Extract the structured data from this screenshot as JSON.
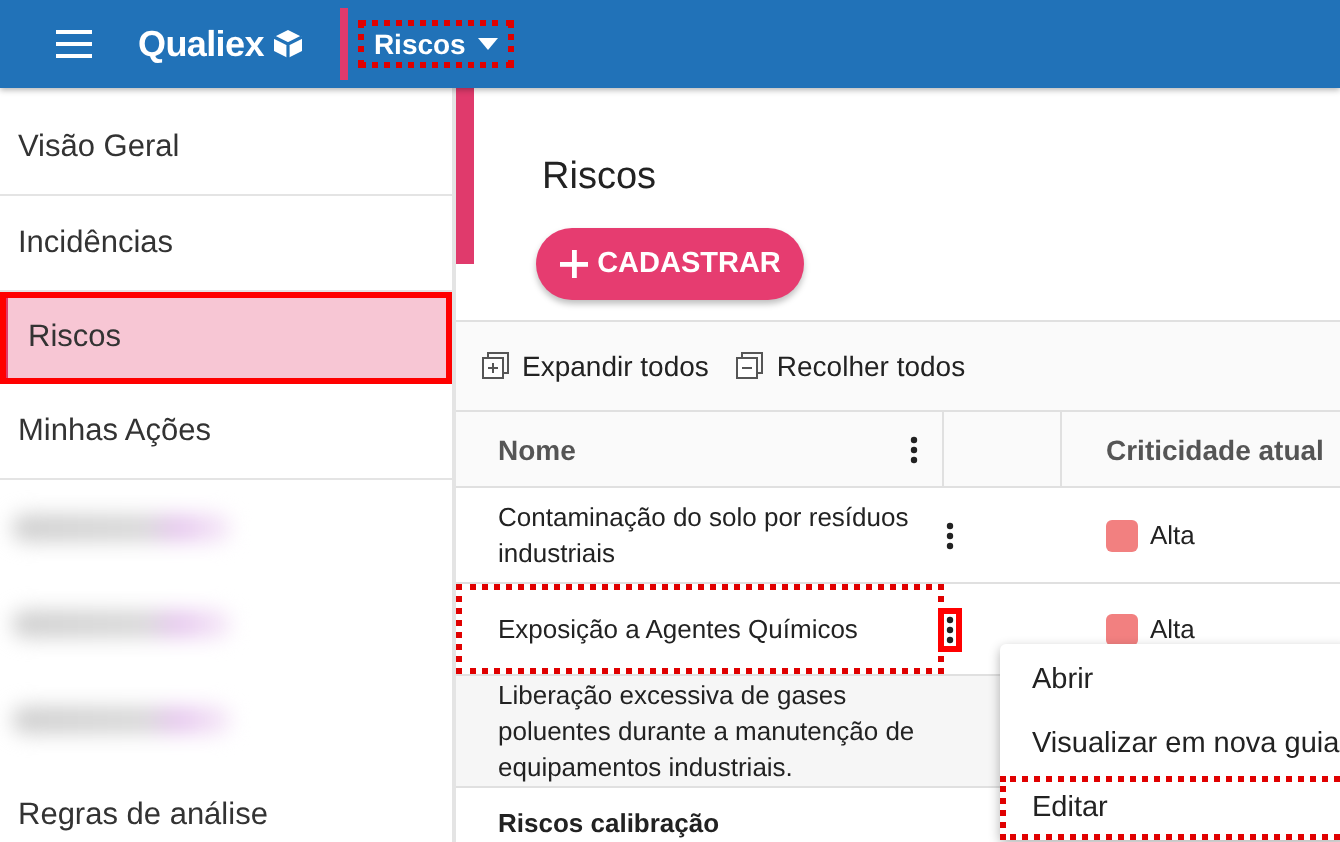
{
  "topbar": {
    "logo": "Qualiex",
    "module": {
      "label": "Riscos",
      "highlighted": true
    }
  },
  "sidebar": {
    "items": [
      {
        "kind": "link",
        "label": "Visão Geral",
        "selected": false,
        "highlighted": false
      },
      {
        "kind": "link",
        "label": "Incidências",
        "selected": false,
        "highlighted": false
      },
      {
        "kind": "link",
        "label": "Riscos",
        "selected": true,
        "highlighted": true
      },
      {
        "kind": "link",
        "label": "Minhas Ações",
        "selected": false,
        "highlighted": false
      },
      {
        "kind": "blurred"
      },
      {
        "kind": "blurred"
      },
      {
        "kind": "blurred"
      },
      {
        "kind": "link",
        "label": "Regras de análise",
        "selected": false,
        "highlighted": false
      }
    ]
  },
  "page": {
    "title": "Riscos",
    "add_button": "CADASTRAR"
  },
  "toolbar": [
    {
      "kind": "expand",
      "label": "Expandir todos"
    },
    {
      "kind": "collapse",
      "label": "Recolher todos"
    }
  ],
  "table": {
    "columns": [
      {
        "kind": "name",
        "label": "Nome"
      },
      {
        "kind": "actions"
      },
      {
        "kind": "criticality",
        "label": "Criticidade atual"
      }
    ],
    "rows": [
      {
        "kind": "risk",
        "name": "Contaminação do solo por resíduos industriais",
        "criticality": "Alta",
        "color": "#f28080",
        "name_highlighted": false,
        "menu_highlighted": false
      },
      {
        "kind": "risk",
        "name": "Exposição a Agentes Químicos",
        "criticality": "Alta",
        "color": "#f28080",
        "name_highlighted": true,
        "menu_highlighted": true
      },
      {
        "kind": "covered",
        "name": "Liberação excessiva de gases poluentes durante a manutenção de equipamentos industriais.",
        "name_highlighted": false
      },
      {
        "kind": "group",
        "name": "Riscos calibração"
      }
    ]
  },
  "context_menu": {
    "items": [
      {
        "label": "Abrir",
        "highlighted": false
      },
      {
        "label": "Visualizar em nova guia",
        "highlighted": false
      },
      {
        "label": "Editar",
        "highlighted": true
      }
    ]
  }
}
